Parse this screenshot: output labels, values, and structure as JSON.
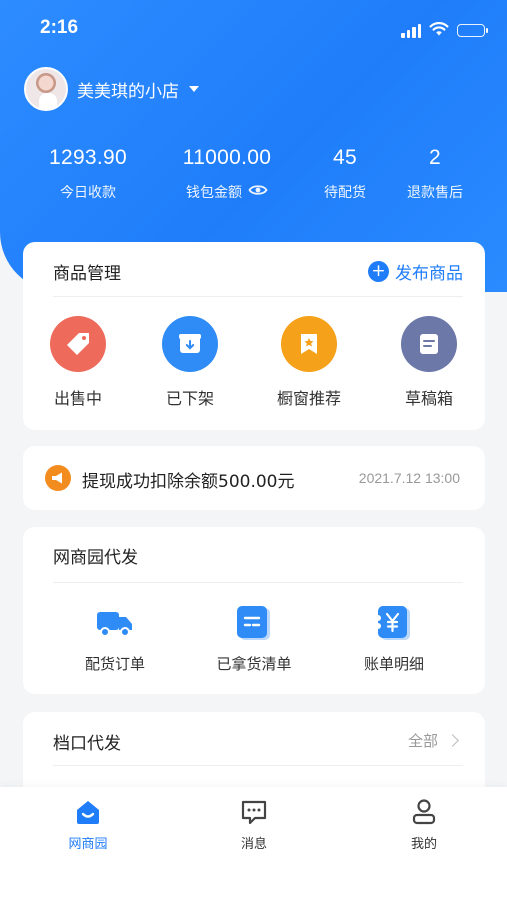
{
  "status_bar": {
    "time": "2:16"
  },
  "store": {
    "name": "美美琪的小店"
  },
  "stats": [
    {
      "value": "1293.90",
      "label": "今日收款"
    },
    {
      "value": "11000.00",
      "label": "钱包金额"
    },
    {
      "value": "45",
      "label": "待配货"
    },
    {
      "value": "2",
      "label": "退款售后"
    }
  ],
  "goods": {
    "title": "商品管理",
    "publish_label": "发布商品",
    "items": [
      {
        "label": "出售中",
        "icon": "tag-icon",
        "color": "#ee6a5b"
      },
      {
        "label": "已下架",
        "icon": "box-download-icon",
        "color": "#2f8cf6"
      },
      {
        "label": "橱窗推荐",
        "icon": "star-bookmark-icon",
        "color": "#f5a11a"
      },
      {
        "label": "草稿箱",
        "icon": "document-icon",
        "color": "#6c78a8"
      }
    ]
  },
  "notice": {
    "text": "提现成功扣除余额500.00元",
    "time": "2021.7.12 13:00"
  },
  "proxy": {
    "title": "网商园代发",
    "items": [
      {
        "label": "配货订单",
        "icon": "truck-icon"
      },
      {
        "label": "已拿货清单",
        "icon": "list-card-icon"
      },
      {
        "label": "账单明细",
        "icon": "yen-bill-icon"
      }
    ]
  },
  "stall": {
    "title": "档口代发",
    "all_label": "全部"
  },
  "tabs": [
    {
      "label": "网商园",
      "icon": "home-icon"
    },
    {
      "label": "消息",
      "icon": "message-icon"
    },
    {
      "label": "我的",
      "icon": "user-icon"
    }
  ],
  "colors": {
    "primary": "#1f7dfa",
    "notice": "#f28c1e"
  }
}
